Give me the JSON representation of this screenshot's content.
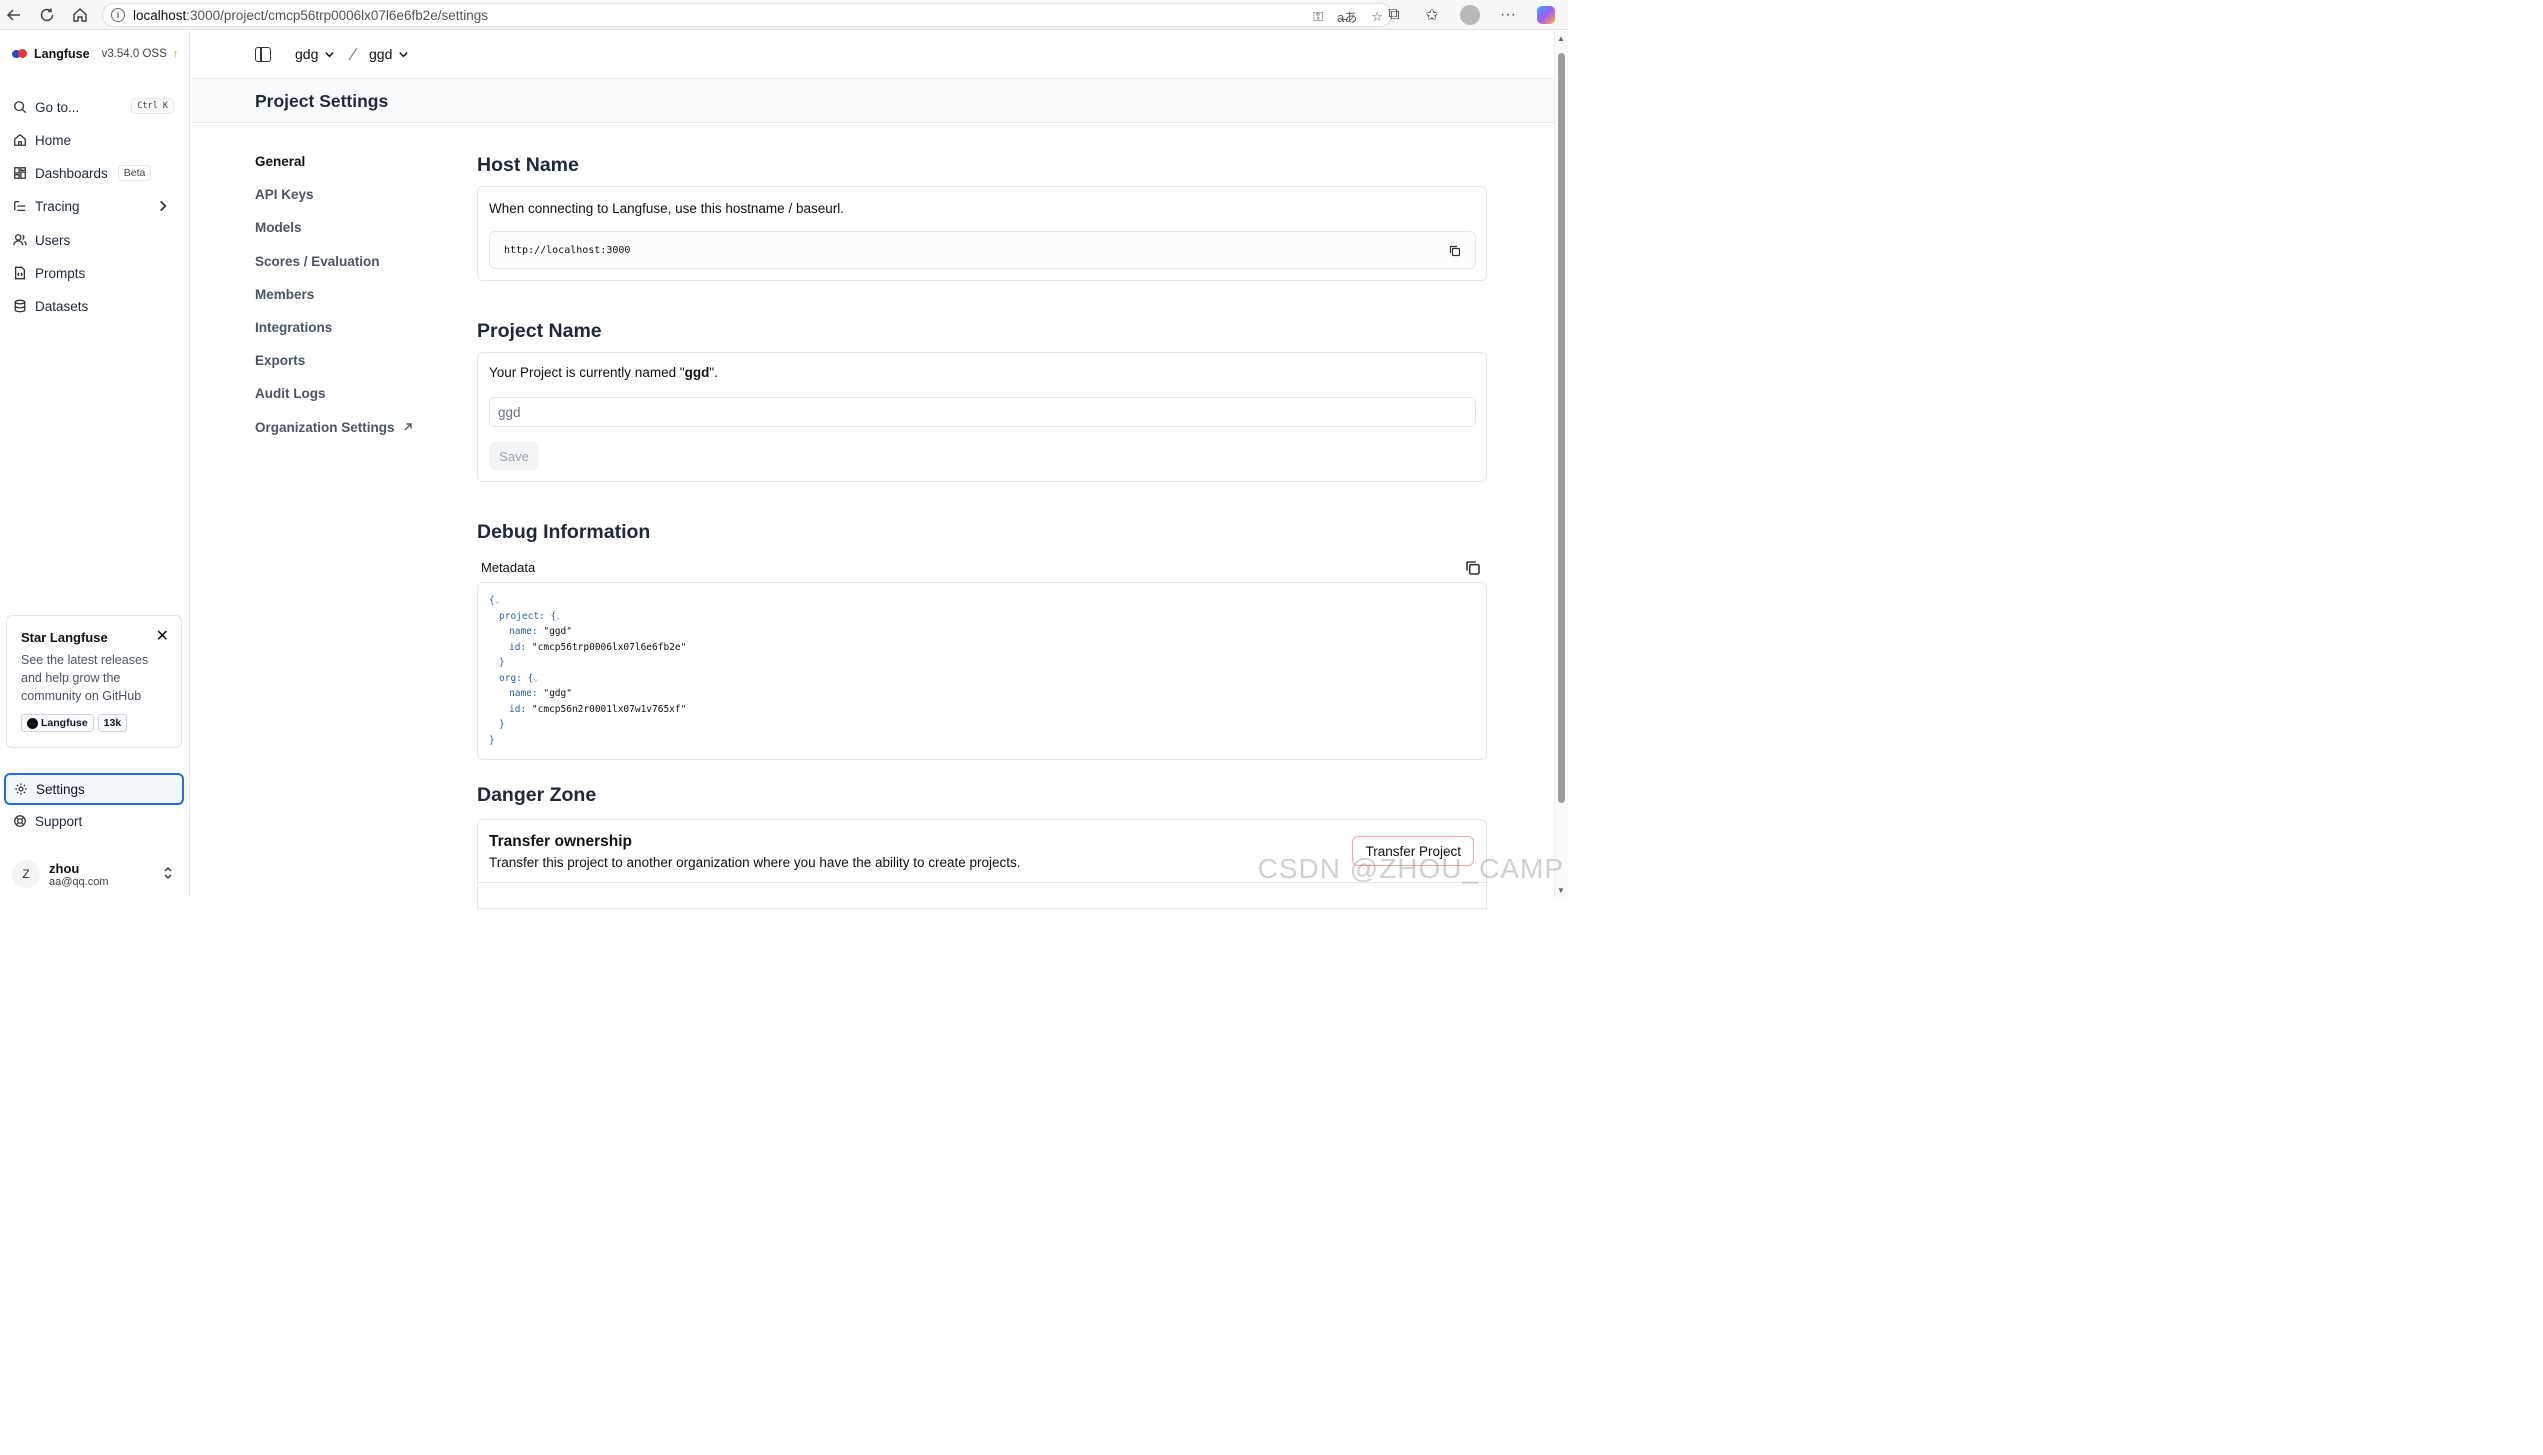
{
  "browser": {
    "url_host": "localhost",
    "url_path": ":3000/project/cmcp56trp0006lx07l6e6fb2e/settings"
  },
  "sidebar": {
    "brand": "Langfuse",
    "version": "v3.54.0 OSS",
    "items": [
      {
        "label": "Go to...",
        "shortcut": "Ctrl K"
      },
      {
        "label": "Home"
      },
      {
        "label": "Dashboards",
        "badge": "Beta"
      },
      {
        "label": "Tracing"
      },
      {
        "label": "Users"
      },
      {
        "label": "Prompts"
      },
      {
        "label": "Datasets"
      }
    ],
    "star_card": {
      "title": "Star Langfuse",
      "description": "See the latest releases and help grow the community on GitHub",
      "repo": "Langfuse",
      "stars": "13k"
    },
    "settings_label": "Settings",
    "support_label": "Support",
    "user": {
      "initial": "Z",
      "name": "zhou",
      "email": "aa@qq.com"
    }
  },
  "header": {
    "org": "gdg",
    "project": "ggd",
    "page_title": "Project Settings"
  },
  "settings_nav": [
    {
      "label": "General"
    },
    {
      "label": "API Keys"
    },
    {
      "label": "Models"
    },
    {
      "label": "Scores / Evaluation"
    },
    {
      "label": "Members"
    },
    {
      "label": "Integrations"
    },
    {
      "label": "Exports"
    },
    {
      "label": "Audit Logs"
    },
    {
      "label": "Organization Settings"
    }
  ],
  "host_name": {
    "title": "Host Name",
    "description": "When connecting to Langfuse, use this hostname / baseurl.",
    "value": "http://localhost:3000"
  },
  "project_name": {
    "title": "Project Name",
    "description_prefix": "Your Project is currently named \"",
    "current_name": "ggd",
    "description_suffix": "\".",
    "input_value": "ggd",
    "save_label": "Save"
  },
  "debug": {
    "title": "Debug Information",
    "metadata_label": "Metadata",
    "project_key": "project:",
    "project_name_key": "name:",
    "project_name_val": "\"ggd\"",
    "project_id_key": "id:",
    "project_id_val": "\"cmcp56trp0006lx07l6e6fb2e\"",
    "org_key": "org:",
    "org_name_key": "name:",
    "org_name_val": "\"gdg\"",
    "org_id_key": "id:",
    "org_id_val": "\"cmcp56n2r0001lx07w1v765xf\""
  },
  "danger_zone": {
    "title": "Danger Zone",
    "transfer_title": "Transfer ownership",
    "transfer_description": "Transfer this project to another organization where you have the ability to create projects.",
    "transfer_button": "Transfer Project"
  },
  "watermark": "CSDN @ZHOU_CAMP"
}
